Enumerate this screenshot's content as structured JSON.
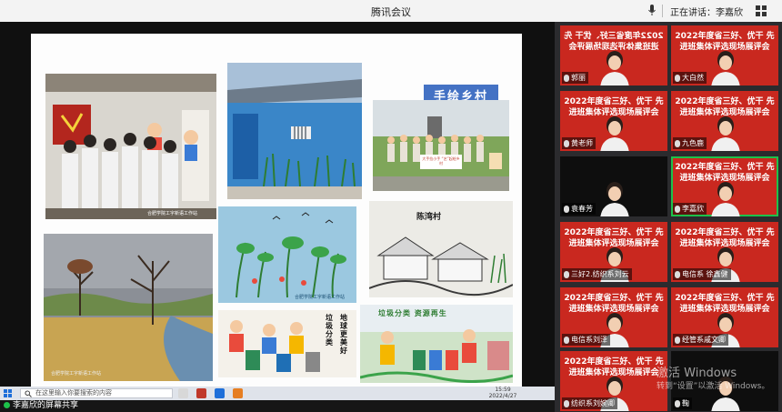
{
  "window": {
    "title": "腾讯会议",
    "speaking_label": "正在讲话：李嘉欣"
  },
  "slide": {
    "title": "手绘乡村",
    "photo_captions": {
      "photo1": "合肥学院工字新语工作站",
      "photo5": "合肥学院工字新语工作站",
      "photo6": "合肥学院工字新语工作站"
    },
    "painted_text": {
      "photo2_banner": "大手拉小手 “艺”起绘乡村",
      "photo4_sign": "陈湾村",
      "photo7_left": "垃圾分类",
      "photo7_right": "地球更美好",
      "photo8_top": "垃圾分类 资源再生"
    }
  },
  "participants": [
    {
      "name": "郭丽",
      "banner": "2022年度省三好、优干 先进班集体评选现场展评会",
      "mirrored": true
    },
    {
      "name": "大白然",
      "banner": "2022年度省三好、优干 先进班集体评选现场展评会",
      "mirrored": false
    },
    {
      "name": "黄老师",
      "banner": "2022年度省三好、优干 先进班集体评选现场展评会",
      "mirrored": false
    },
    {
      "name": "九色鹿",
      "banner": "2022年度省三好、优干 先进班集体评选现场展评会",
      "mirrored": false
    },
    {
      "name": "袁春芳",
      "banner": "",
      "mirrored": false
    },
    {
      "name": "李嘉欣",
      "banner": "2022年度省三好、优干 先进班集体评选现场展评会",
      "mirrored": false
    },
    {
      "name": "三好2.纺织系刘云",
      "banner": "2022年度省三好、优干 先进班集体评选现场展评会",
      "mirrored": false
    },
    {
      "name": "电信系 徐鑫健",
      "banner": "2022年度省三好、优干 先进班集体评选现场展评会",
      "mirrored": false
    },
    {
      "name": "电信系刘泽",
      "banner": "2022年度省三好、优干 先进班集体评选现场展评会",
      "mirrored": false
    },
    {
      "name": "经管系戚文卿",
      "banner": "2022年度省三好、优干 先进班集体评选现场展评会",
      "mirrored": false
    },
    {
      "name": "纺织系刘婉卿",
      "banner": "2022年度省三好、优干 先进班集体评选现场展评会",
      "mirrored": false
    },
    {
      "name": "鞠",
      "banner": "",
      "mirrored": false
    }
  ],
  "taskbar": {
    "search_placeholder": "在这里输入你要搜索的内容",
    "time": "15:59",
    "date": "2022/4/27"
  },
  "screen_share": {
    "label": "李嘉欣的屏幕共享"
  },
  "watermark": {
    "line1": "激活 Windows",
    "line2": "转到“设置”以激活 Windows。"
  },
  "colors": {
    "accent_green": "#1dc14a",
    "banner_red": "#c9281f",
    "slide_title_blue": "#4472c4"
  }
}
